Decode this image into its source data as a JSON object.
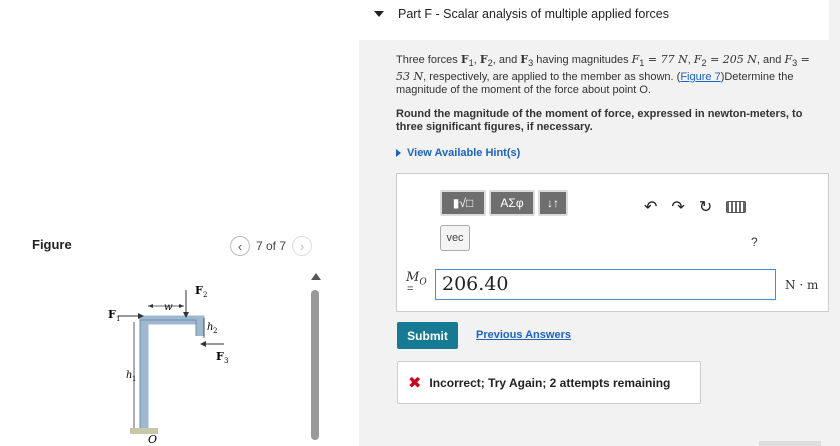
{
  "figure": {
    "title": "Figure",
    "pager_text": "7 of 7",
    "labels": {
      "F1": "F",
      "F1_sub": "1",
      "F2": "F",
      "F2_sub": "2",
      "F3": "F",
      "F3_sub": "3",
      "w": "w",
      "h1": "h",
      "h1_sub": "1",
      "h2": "h",
      "h2_sub": "2",
      "O": "O"
    }
  },
  "part": {
    "title": "Part F - Scalar analysis of multiple applied forces",
    "q1": "Three forces ",
    "f1": "F",
    "f1s": "1",
    "c1": ", ",
    "f2": "F",
    "f2s": "2",
    "c2": ", and ",
    "f3": "F",
    "f3s": "3",
    "q2": " having magnitudes ",
    "m1": "F",
    "m1s": "1",
    "m1v": " = 77 N",
    "c3": ", ",
    "m2": "F",
    "m2s": "2",
    "m2v": " = 205 N",
    "c4": ", and ",
    "m3": "F",
    "m3s": "3",
    "m3v": " = 53 N",
    "q3": ", respectively, are applied to the member as shown. (",
    "figure_link": "Figure 7",
    "q4": ")Determine the magnitude of the moment of the force about point O.",
    "instruction": "Round the magnitude of the moment of force, expressed in newton-meters, to three significant figures, if necessary.",
    "hints_label": "View Available Hint(s)"
  },
  "toolbar": {
    "btn1": "▮√□",
    "btn2": "ΑΣφ",
    "btn3": "↓↑",
    "vec": "vec",
    "undo": "↶",
    "redo": "↷",
    "reset": "↻",
    "help": "?"
  },
  "answer": {
    "label_main": "M",
    "label_sub": "O",
    "eq": "=",
    "value": "206.40",
    "units": "N · m"
  },
  "actions": {
    "submit": "Submit",
    "previous": "Previous Answers"
  },
  "feedback": {
    "icon": "✖",
    "text": "Incorrect; Try Again; 2 attempts remaining"
  }
}
